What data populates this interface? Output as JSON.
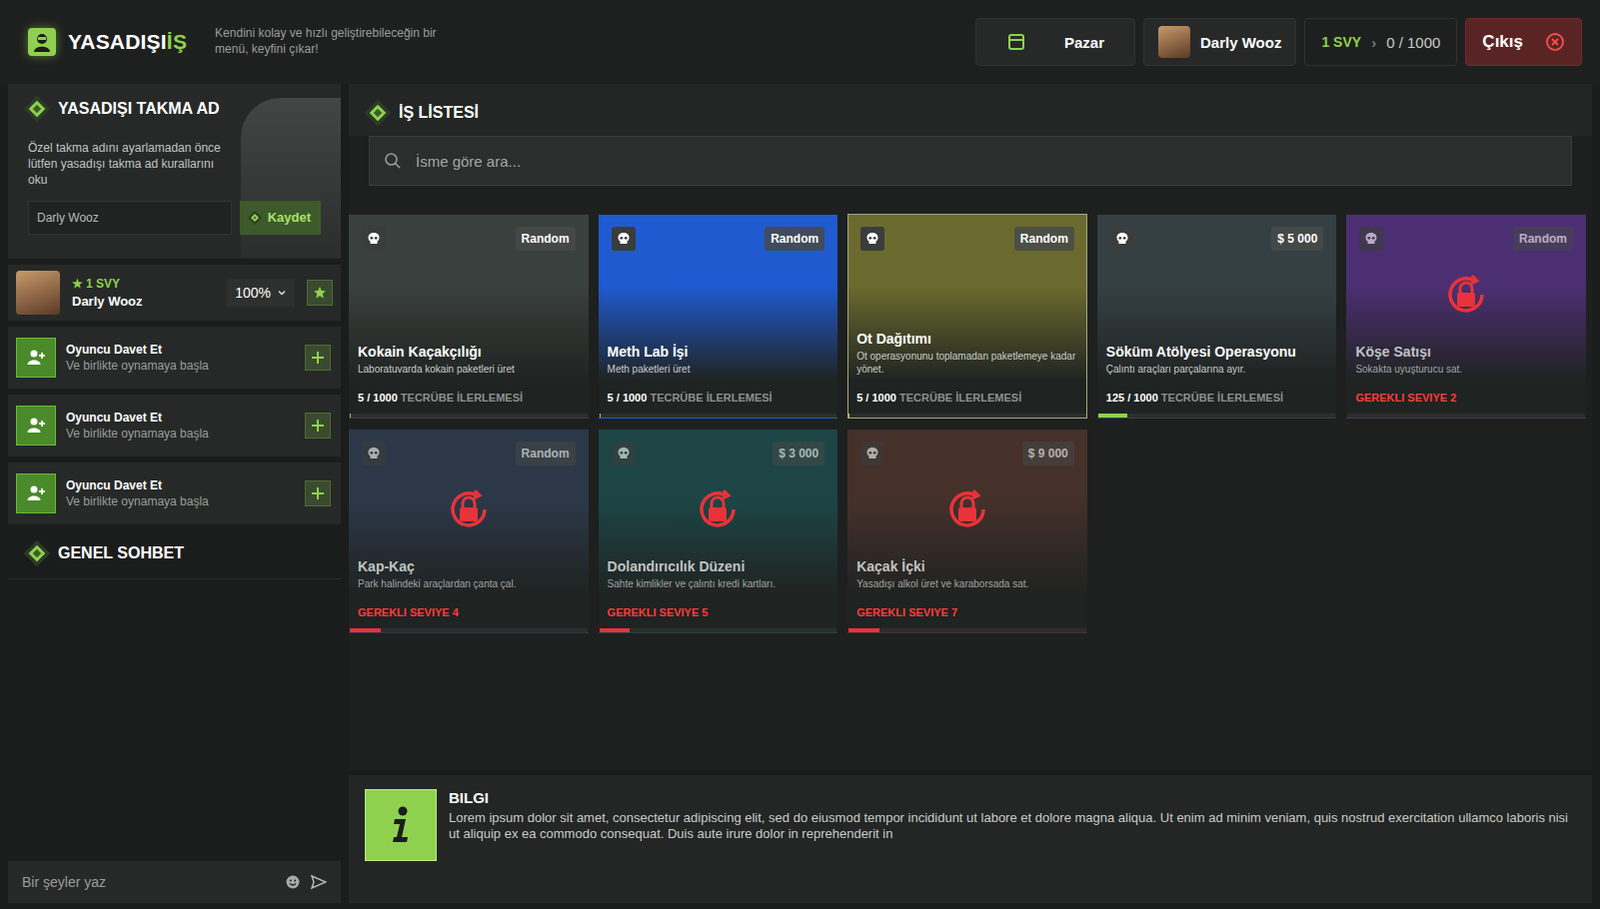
{
  "header": {
    "logo": {
      "main": "YASADIŞI",
      "accent": "İŞ"
    },
    "subtitle": "Kendini kolay ve hızlı geliştirebileceğin bir menü, keyfini çıkar!",
    "market_button": "Pazar",
    "user": {
      "name": "Darly Wooz"
    },
    "level": {
      "label": "1 SVY",
      "separator": "›",
      "xp": "0 / 1000"
    },
    "exit_button": "Çıkış"
  },
  "nickname_panel": {
    "title": "YASADIŞI TAKMA AD",
    "description": "Özel takma adını ayarlamadan önce lütfen yasadışı takma ad kurallarını oku",
    "input_value": "Darly Wooz",
    "save_button": "Kaydet"
  },
  "player": {
    "level": "1 SVY",
    "name": "Darly Wooz",
    "volume": "100%"
  },
  "invites": [
    {
      "title": "Oyuncu Davet Et",
      "subtitle": "Ve birlikte oynamaya başla"
    },
    {
      "title": "Oyuncu Davet Et",
      "subtitle": "Ve birlikte oynamaya başla"
    },
    {
      "title": "Oyuncu Davet Et",
      "subtitle": "Ve birlikte oynamaya başla"
    }
  ],
  "chat": {
    "title": "GENEL SOHBET",
    "placeholder": "Bir şeyler yaz"
  },
  "jobs": {
    "title": "İŞ LİSTESİ",
    "search_placeholder": "İsme göre ara...",
    "cards": [
      {
        "title": "Kokain Kaçakçılığı",
        "description": "Laboratuvarda kokain paketleri üret",
        "tag": "Random",
        "progress": "5 / 1000",
        "progress_label": "TECRÜBE İLERLEMESİ",
        "required": "",
        "locked": false,
        "selected": false,
        "level": 0.005,
        "color": "#3a403d"
      },
      {
        "title": "Meth Lab İşi",
        "description": "Meth paketleri üret",
        "tag": "Random",
        "progress": "5 / 1000",
        "progress_label": "TECRÜBE İLERLEMESİ",
        "required": "",
        "locked": false,
        "selected": false,
        "level": 0.005,
        "color": "#1f5ad0"
      },
      {
        "title": "Ot Dağıtımı",
        "description": "Ot operasyonunu toplamadan paketlemeye kadar yönet.",
        "tag": "Random",
        "progress": "5 / 1000",
        "progress_label": "TECRÜBE İLERLEMESİ",
        "required": "",
        "locked": false,
        "selected": true,
        "level": 0.005,
        "color": "#6b6a2e"
      },
      {
        "title": "Söküm Atölyesi Operasyonu",
        "description": "Çalıntı araçları parçalarına ayır.",
        "tag": "$ 5 000",
        "progress": "125 / 1000",
        "progress_label": "TECRÜBE İLERLEMESİ",
        "required": "",
        "locked": false,
        "selected": false,
        "level": 0.125,
        "color": "#354045"
      },
      {
        "title": "Köşe Satışı",
        "description": "Sokakta uyuşturucu sat.",
        "tag": "Random",
        "progress": "",
        "progress_label": "",
        "required": "GEREKLI SEVIYE 2",
        "locked": true,
        "selected": false,
        "level": 0,
        "color": "#4c2f72"
      },
      {
        "title": "Kap-Kaç",
        "description": "Park halindeki araçlardan çanta çal.",
        "tag": "Random",
        "progress": "",
        "progress_label": "",
        "required": "GEREKLI SEVIYE 4",
        "locked": true,
        "selected": false,
        "level": 0.13,
        "color": "#2c3848"
      },
      {
        "title": "Dolandırıcılık Düzeni",
        "description": "Sahte kimlikler ve çalıntı kredi kartları.",
        "tag": "$ 3 000",
        "progress": "",
        "progress_label": "",
        "required": "GEREKLI SEVIYE 5",
        "locked": true,
        "selected": false,
        "level": 0.13,
        "color": "#1d4546"
      },
      {
        "title": "Kaçak İçki",
        "description": "Yasadışı alkol üret ve karaborsada sat.",
        "tag": "$ 9 000",
        "progress": "",
        "progress_label": "",
        "required": "GEREKLI SEVIYE 7",
        "locked": true,
        "selected": false,
        "level": 0.13,
        "color": "#45302a"
      }
    ]
  },
  "info": {
    "title": "BILGI",
    "text": "Lorem ipsum dolor sit amet, consectetur adipiscing elit, sed do eiusmod tempor incididunt ut labore et dolore magna aliqua. Ut enim ad minim veniam, quis nostrud exercitation ullamco laboris nisi ut aliquip ex ea commodo consequat. Duis aute irure dolor in reprehenderit in"
  }
}
